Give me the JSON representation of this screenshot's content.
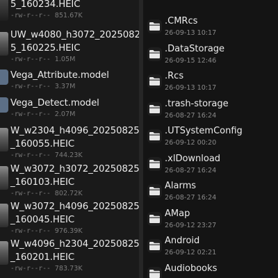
{
  "left_files": [
    {
      "name_lines": [
        "5_160234.HEIC"
      ],
      "perms": "-rw-r--r--",
      "size": "851.67K",
      "icon": "image-thumbnail"
    },
    {
      "name_lines": [
        "UW_w4080_h3072_2025082",
        "5_160225.HEIC"
      ],
      "perms": "-rw-r--r--",
      "size": "1.05M",
      "icon": "image-thumbnail"
    },
    {
      "name_lines": [
        "Vega_Attribute.model"
      ],
      "perms": "-rw-r--r--",
      "size": "3.37M",
      "icon": "model-file-icon"
    },
    {
      "name_lines": [
        "Vega_Detect.model"
      ],
      "perms": "-rw-r--r--",
      "size": "2.07M",
      "icon": "model-file-icon"
    },
    {
      "name_lines": [
        "W_w2304_h4096_20250825",
        "_160055.HEIC"
      ],
      "perms": "-rw-r--r--",
      "size": "744.23K",
      "icon": "image-thumbnail"
    },
    {
      "name_lines": [
        "W_w3072_h3072_20250825",
        "_160103.HEIC"
      ],
      "perms": "-rw-r--r--",
      "size": "802.72K",
      "icon": "image-thumbnail"
    },
    {
      "name_lines": [
        "W_w3072_h4096_20250825",
        "_160045.HEIC"
      ],
      "perms": "-rw-r--r--",
      "size": "976.39K",
      "icon": "image-thumbnail"
    },
    {
      "name_lines": [
        "W_w4096_h2304_20250825",
        "_160201.HEIC"
      ],
      "perms": "-rw-r--r--",
      "size": "783.73K",
      "icon": "image-thumbnail"
    }
  ],
  "right_folders": [
    {
      "name": ".CMRcs",
      "date": "26-09-13 10:17",
      "icon": "folder-icon"
    },
    {
      "name": ".DataStorage",
      "date": "26-09-15 12:46",
      "icon": "folder-icon"
    },
    {
      "name": ".Rcs",
      "date": "26-09-13 10:17",
      "icon": "folder-icon"
    },
    {
      "name": ".trash-storage",
      "date": "26-08-27 16:24",
      "icon": "folder-icon"
    },
    {
      "name": ".UTSystemConfig",
      "date": "26-09-12 00:20",
      "icon": "folder-icon"
    },
    {
      "name": ".xlDownload",
      "date": "26-08-27 16:24",
      "icon": "folder-icon"
    },
    {
      "name": "Alarms",
      "date": "26-08-27 16:24",
      "icon": "folder-icon"
    },
    {
      "name": "AMap",
      "date": "26-09-12 23:27",
      "icon": "folder-icon"
    },
    {
      "name": "Android",
      "date": "26-09-12 02:21",
      "icon": "folder-icon"
    },
    {
      "name": "Audiobooks",
      "date": "",
      "icon": "folder-icon"
    }
  ],
  "colors": {
    "background": "#161616",
    "folder_icon": "#e6e6e6",
    "meta_text": "#7a7a7a"
  }
}
